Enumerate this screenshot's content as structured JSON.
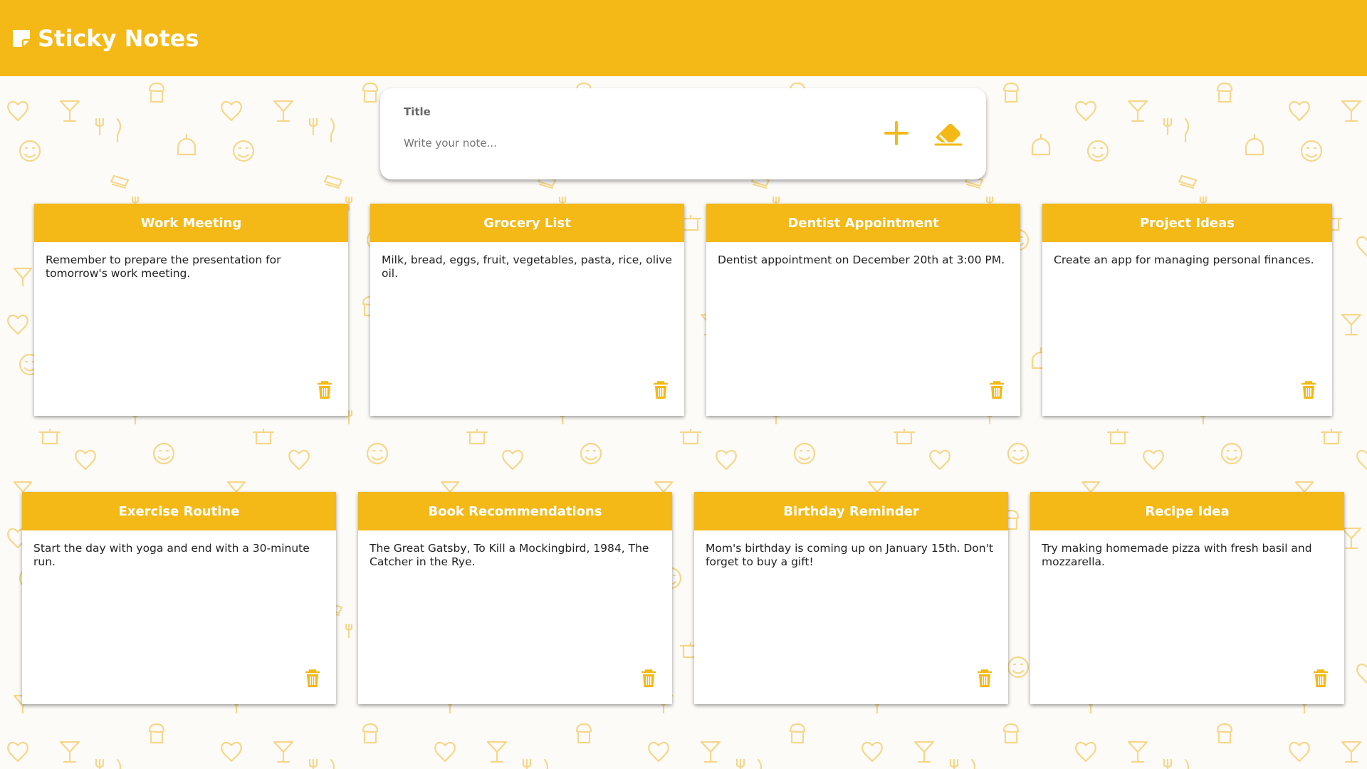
{
  "app": {
    "title": "Sticky Notes",
    "accent_color": "#f4b917",
    "logo_icon": "sticky-note-icon"
  },
  "form": {
    "title_placeholder": "Title",
    "text_placeholder": "Write your note...",
    "add_icon": "plus-icon",
    "clear_icon": "eraser-icon"
  },
  "notes": [
    {
      "title": "Work Meeting",
      "text": "Remember to prepare the presentation for tomorrow's work meeting."
    },
    {
      "title": "Grocery List",
      "text": "Milk, bread, eggs, fruit, vegetables, pasta, rice, olive oil."
    },
    {
      "title": "Dentist Appointment",
      "text": "Dentist appointment on December 20th at 3:00 PM."
    },
    {
      "title": "Project Ideas",
      "text": "Create an app for managing personal finances."
    },
    {
      "title": "Exercise Routine",
      "text": "Start the day with yoga and end with a 30-minute run."
    },
    {
      "title": "Book Recommendations",
      "text": "The Great Gatsby, To Kill a Mockingbird, 1984, The Catcher in the Rye."
    },
    {
      "title": "Birthday Reminder",
      "text": "Mom's birthday is coming up on January 15th. Don't forget to buy a gift!"
    },
    {
      "title": "Recipe Idea",
      "text": "Try making homemade pizza with fresh basil and mozzarella."
    }
  ]
}
